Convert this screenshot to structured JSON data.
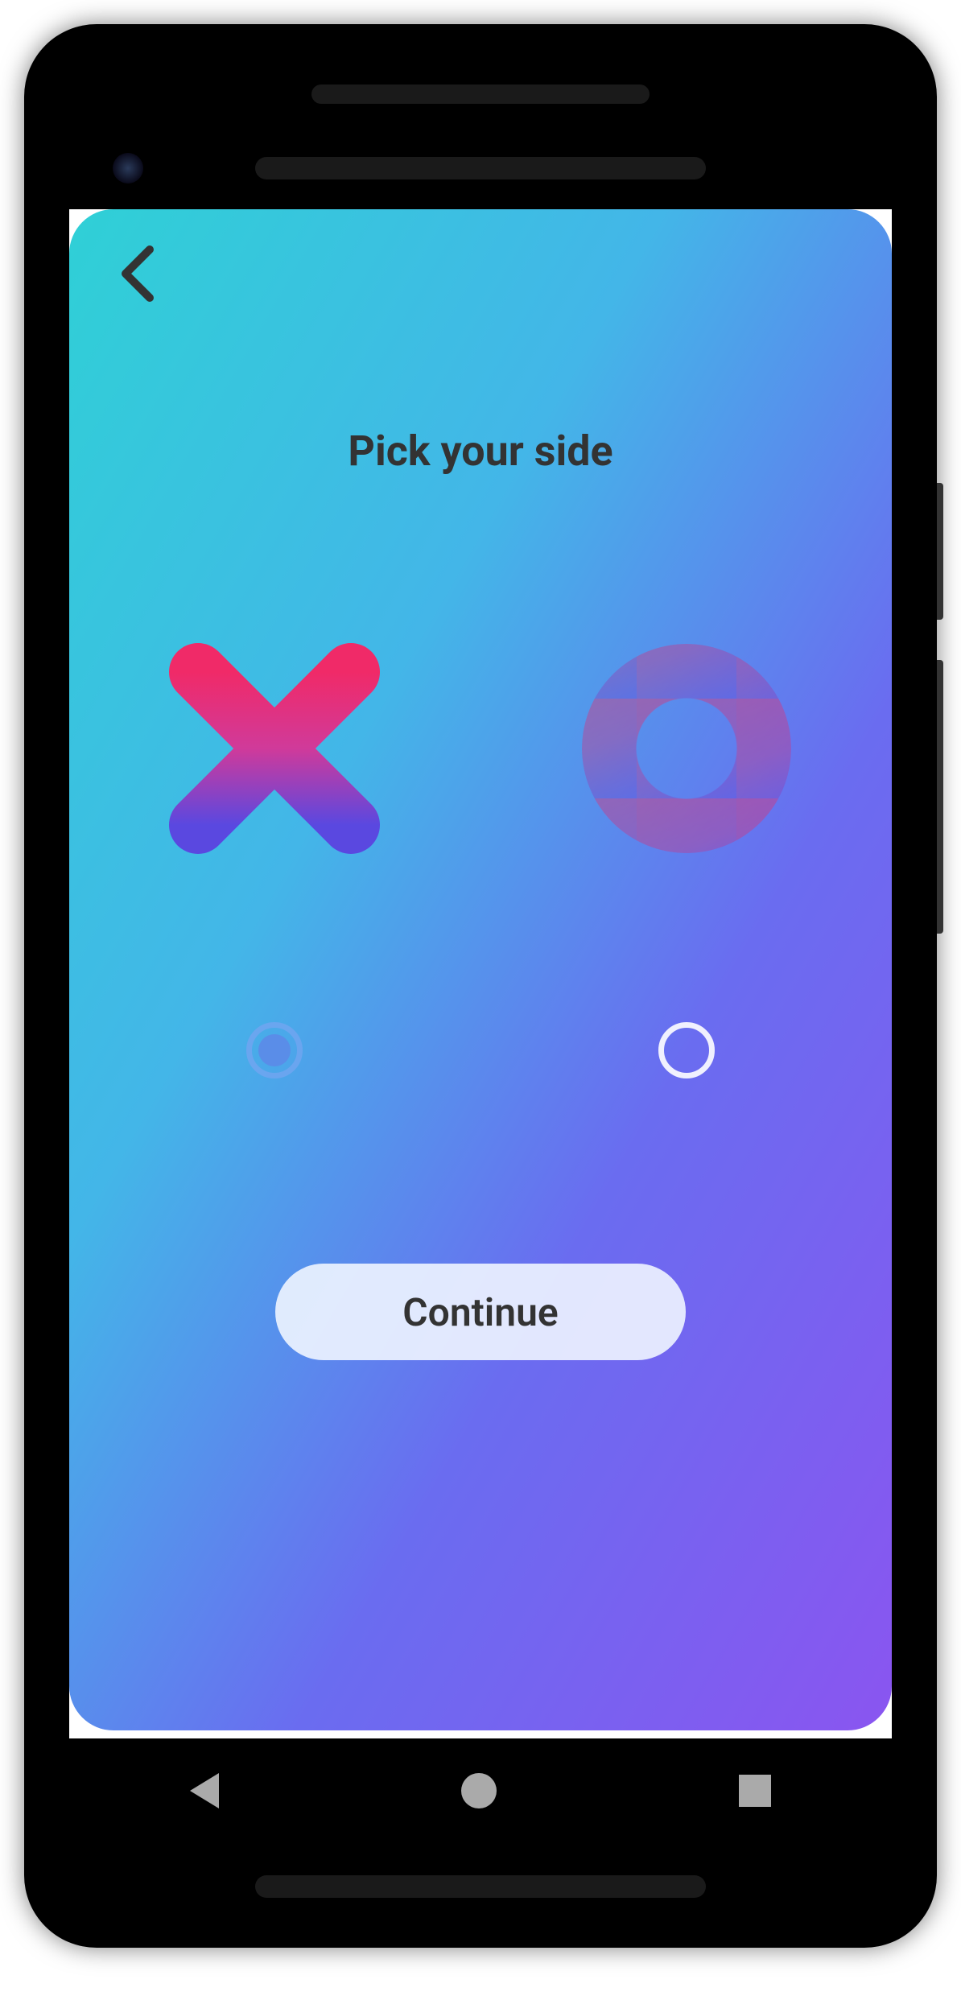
{
  "header": {
    "title": "Pick your side"
  },
  "options": {
    "x_selected": true,
    "o_selected": false
  },
  "continue_button": {
    "label": "Continue"
  },
  "colors": {
    "gradient_start": "#2fd0d6",
    "gradient_end": "#8a55f0",
    "x_gradient_top": "#ea2d6a",
    "x_gradient_bottom": "#5a48e0"
  }
}
